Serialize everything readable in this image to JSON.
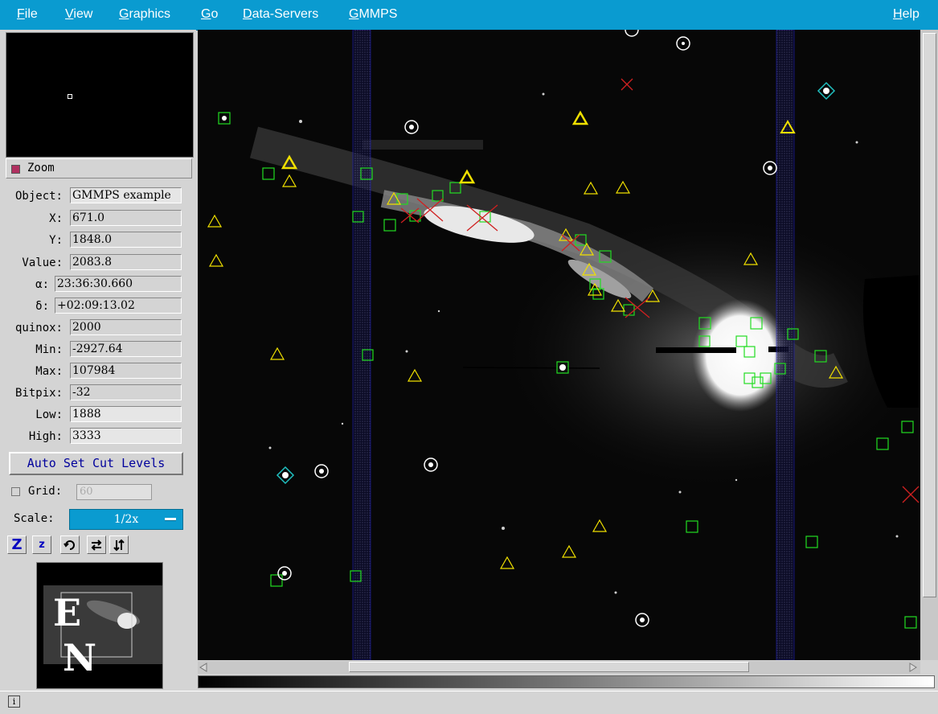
{
  "menu": {
    "file": "File",
    "view": "View",
    "graphics": "Graphics",
    "go": "Go",
    "data_servers": "Data-Servers",
    "gmmps": "GMMPS",
    "help": "Help"
  },
  "panel": {
    "zoom_label": "Zoom",
    "fields": {
      "object": {
        "label": "Object:",
        "value": "GMMPS example"
      },
      "x": {
        "label": "X:",
        "value": "671.0"
      },
      "y": {
        "label": "Y:",
        "value": "1848.0"
      },
      "value": {
        "label": "Value:",
        "value": "2083.8"
      },
      "alpha": {
        "label": "α:",
        "value": "23:36:30.660"
      },
      "delta": {
        "label": "δ:",
        "value": "+02:09:13.02"
      },
      "equinox": {
        "label": "quinox:",
        "value": "2000"
      },
      "min": {
        "label": "Min:",
        "value": "-2927.64"
      },
      "max": {
        "label": "Max:",
        "value": "107984"
      },
      "bitpix": {
        "label": "Bitpix:",
        "value": "-32"
      },
      "low": {
        "label": "Low:",
        "value": "1888"
      },
      "high": {
        "label": "High:",
        "value": "3333"
      }
    },
    "auto_set_label": "Auto Set Cut Levels",
    "grid_label": "Grid:",
    "grid_value": "60",
    "scale_label": "Scale:",
    "scale_value": "1/2x"
  },
  "colors": {
    "menubar": "#0a9bd0",
    "square_marker": "#22dd22",
    "triangle_marker": "#f0e000",
    "cross_marker": "#d02020",
    "circle_marker": "#ffffff",
    "diamond_marker": "#20c0c0",
    "slit_band": "#1c1c9c"
  },
  "icons": {
    "zoom_in": "zoom-in-icon",
    "zoom_out": "zoom-out-icon",
    "rotate": "rotate-icon",
    "flip_x": "flip-x-icon",
    "flip_y": "flip-y-icon",
    "info": "info-icon"
  }
}
